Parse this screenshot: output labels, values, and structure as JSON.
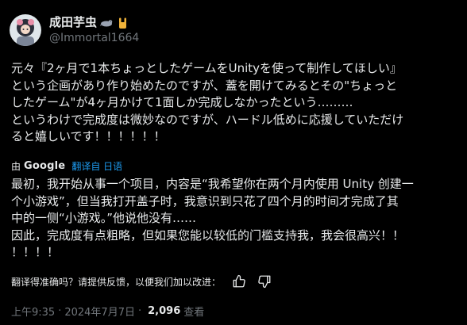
{
  "author": {
    "display_name": "成田芋虫",
    "handle": "@Immortal1664",
    "badges": [
      "seal-emoji-icon",
      "rock-hand-emoji-icon"
    ]
  },
  "post": {
    "original_lines": [
      "元々『2ヶ月で1本ちょっとしたゲームをUnityを使って制作してほしい』",
      "という企画があり作り始めたのですが、蓋を開けてみるとその\"ちょっと",
      "したゲーム\"が4ヶ月かけて1面しか完成しなかったという………",
      "というわけで完成度は微妙なのですが、ハードル低めに応援していただけ",
      "ると嬉しいです！！！！！！"
    ],
    "translation_attribution": {
      "by": "由",
      "provider": "Google",
      "translated_from": "翻译自 日语"
    },
    "translated_lines": [
      "最初，我开始从事一个项目，内容是“我希望你在两个月内使用 Unity 创建一",
      "个小游戏”，但当我打开盖子时，我意识到只花了四个月的时间才完成了其",
      "中的一侧“小游戏。”他说他没有……",
      "因此，完成度有点粗略，但如果您能以较低的门槛支持我，我会很高兴！！",
      "！！！！"
    ],
    "feedback": {
      "prompt": "翻译得准确吗？请提供反馈，以便我们加以改进：",
      "thumbs_up_icon": "thumbs-up-icon",
      "thumbs_down_icon": "thumbs-down-icon"
    },
    "meta": {
      "time": "上午9:35",
      "separator": "·",
      "date": "2024年7月7日",
      "views_count": "2,096",
      "views_label": "查看"
    }
  },
  "colors": {
    "background": "#000000",
    "text_primary": "#e7e9ea",
    "text_secondary": "#71767b",
    "link": "#1d9bf0"
  }
}
